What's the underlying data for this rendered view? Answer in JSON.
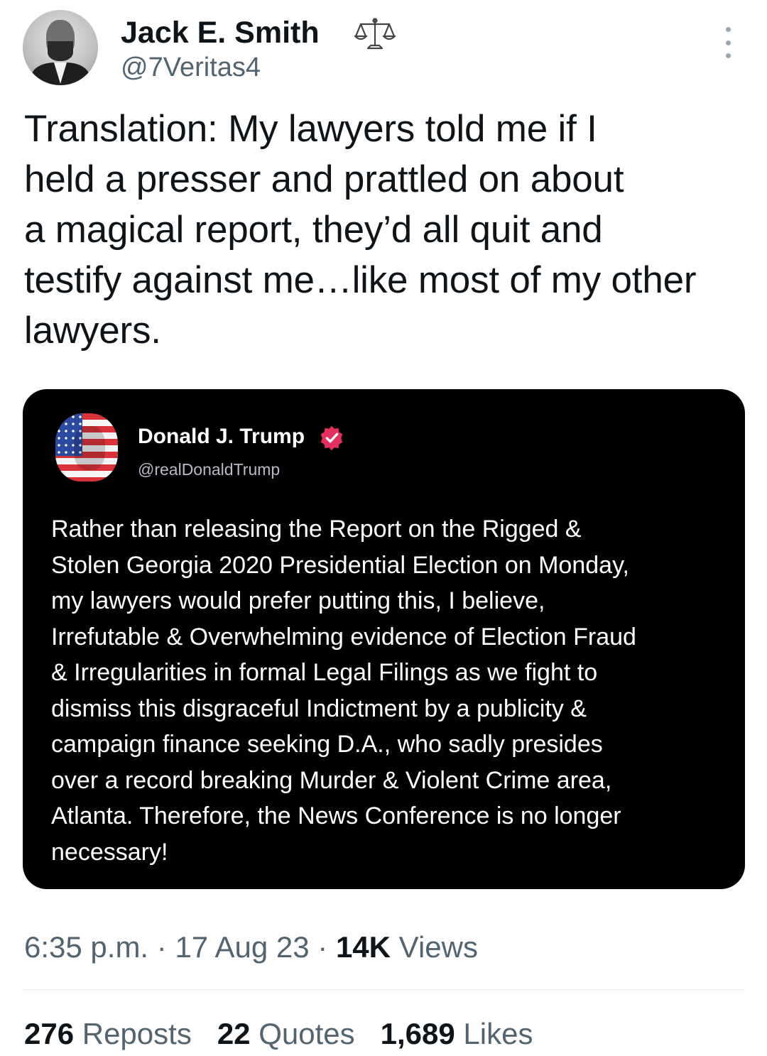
{
  "tweet": {
    "author": {
      "display_name": "Jack E. Smith",
      "handle": "@7Veritas4",
      "badge_icon": "scales-icon"
    },
    "text": "Translation: My lawyers told me if I\nheld a presser and prattled on about\na magical report, they’d all quit and\ntestify against me…like most of my other\nlawyers.",
    "more_icon": "more-vertical-icon"
  },
  "quote": {
    "author": {
      "display_name": "Donald J. Trump",
      "handle": "@realDonaldTrump",
      "verified_icon": "verified-badge-icon",
      "verified_color": "#e4305f"
    },
    "text": "Rather than releasing the Report on the Rigged &\nStolen Georgia 2020 Presidential Election on Monday,\nmy lawyers would prefer putting this, I believe,\nIrrefutable & Overwhelming evidence of Election Fraud\n& Irregularities in formal Legal Filings as we fight to\ndismiss this disgraceful Indictment by a publicity &\ncampaign finance seeking D.A., who sadly presides\nover a record breaking Murder & Violent Crime area,\nAtlanta. Therefore, the News Conference is no longer\nnecessary!"
  },
  "meta": {
    "time": "6:35 p.m.",
    "separator": " · ",
    "date": "17 Aug 23",
    "views_count": "14K",
    "views_label": " Views"
  },
  "stats": {
    "reposts_count": "276",
    "reposts_label": " Reposts",
    "quotes_count": "22",
    "quotes_label": " Quotes",
    "likes_count": "1,689",
    "likes_label": " Likes"
  },
  "colors": {
    "text_primary": "#0f1419",
    "text_secondary": "#536471",
    "card_background": "#000000"
  }
}
